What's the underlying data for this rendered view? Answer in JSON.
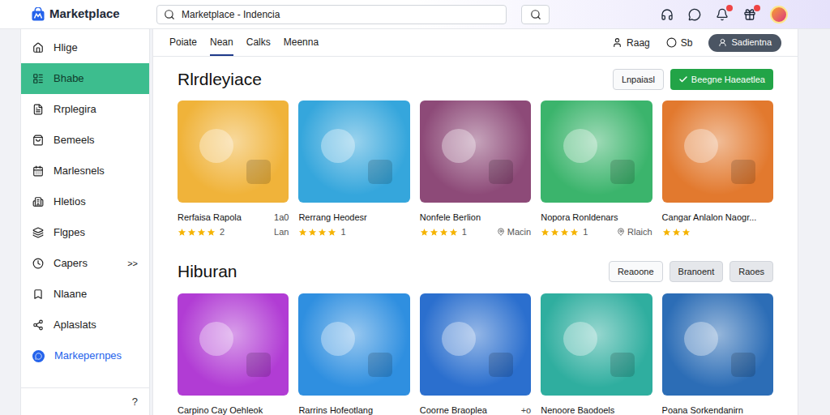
{
  "app": {
    "title": "Marketplace"
  },
  "search": {
    "value": "Marketplace - Indencia"
  },
  "toolbar_icons": [
    {
      "badge": false
    },
    {
      "badge": false
    },
    {
      "badge": true
    },
    {
      "badge": true
    }
  ],
  "sidebar": {
    "items": [
      {
        "label": "Hlige",
        "selected": false
      },
      {
        "label": "Bhabe",
        "selected": true
      },
      {
        "label": "Rrplegira",
        "selected": false
      },
      {
        "label": "Bemeels",
        "selected": false
      },
      {
        "label": "Marlesnels",
        "selected": false
      },
      {
        "label": "Hletios",
        "selected": false
      },
      {
        "label": "Flgpes",
        "selected": false
      },
      {
        "label": "Capers",
        "selected": false,
        "chevron": ">>"
      },
      {
        "label": "Nlaane",
        "selected": false
      },
      {
        "label": "Aplaslats",
        "selected": false
      },
      {
        "label": "Markepernpes",
        "selected": false,
        "color": "#2563eb"
      }
    ],
    "help": "?"
  },
  "tabs": [
    {
      "label": "Poiate",
      "selected": false
    },
    {
      "label": "Nean",
      "selected": true
    },
    {
      "label": "Calks",
      "selected": false
    },
    {
      "label": "Meenna",
      "selected": false
    }
  ],
  "tab_actions": {
    "user": "Raag",
    "status": "Sb",
    "button": "Sadientna"
  },
  "sections": [
    {
      "title": "Rlrdleyiace",
      "buttons": [
        {
          "label": "Lnpaiasl",
          "kind": "outline"
        },
        {
          "label": "Beegne Haeaetlea",
          "kind": "primary"
        }
      ],
      "cards": [
        {
          "title": "Rerfaisa Rapola",
          "meta": "1a0",
          "stars": 4,
          "count": "2",
          "side": {
            "text": "Lan",
            "icon": false
          },
          "color": "#f0b33a"
        },
        {
          "title": "Rerrang Heodesr",
          "stars": 4,
          "count": "1",
          "color": "#35a6dc"
        },
        {
          "title": "Nonfele Berlion",
          "stars": 4,
          "count": "1",
          "side": {
            "text": "Macin",
            "icon": true
          },
          "color": "#8d4a78"
        },
        {
          "title": "Nopora Ronldenars",
          "stars": 4,
          "count": "1",
          "side": {
            "text": "Rlaich",
            "icon": true
          },
          "color": "#3bb46c"
        },
        {
          "title": "Cangar Anlalon Naogr...",
          "stars": 3,
          "color": "#e2792e"
        }
      ]
    },
    {
      "title": "Hiburan",
      "buttons": [
        {
          "label": "Reaoone",
          "kind": "outline"
        },
        {
          "label": "Branoent",
          "kind": "gray"
        },
        {
          "label": "Raoes",
          "kind": "gray"
        }
      ],
      "cards": [
        {
          "title": "Carpino Cay Oehleok",
          "color": "#b13cd4"
        },
        {
          "title": "Rarrins Hofeotlang",
          "color": "#2f8fe0"
        },
        {
          "title": "Coorne Braoplea",
          "meta": "+o",
          "color": "#2b6fce"
        },
        {
          "title": "Nenoore Baodoels",
          "color": "#2fae9f"
        },
        {
          "title": "Poana Sorkendanirn",
          "color": "#2c6db6"
        }
      ]
    }
  ]
}
